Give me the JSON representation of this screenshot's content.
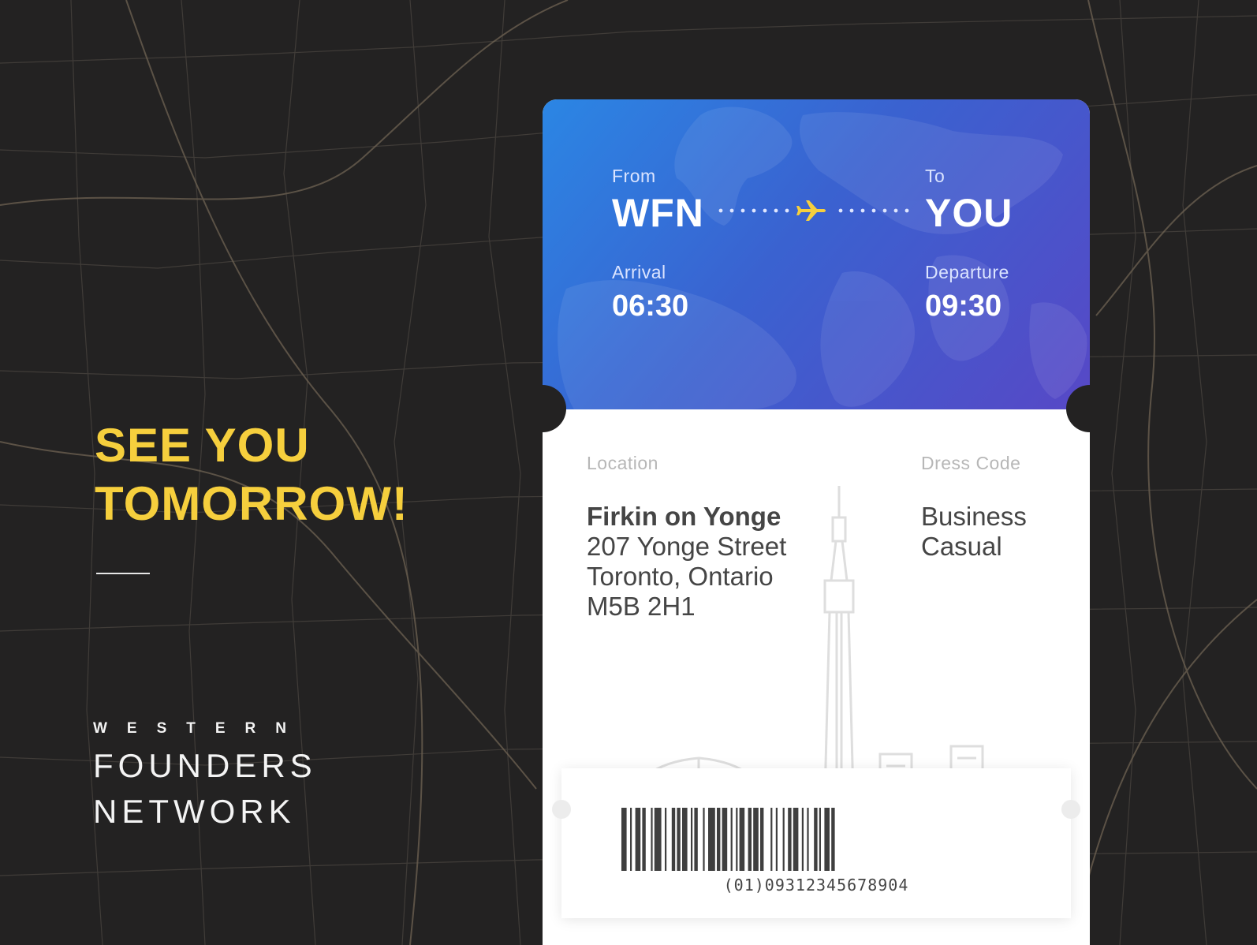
{
  "headline": {
    "line1": "SEE YOU",
    "line2": "TOMORROW!"
  },
  "brand": {
    "top": "WESTERN",
    "line1": "FOUNDERS",
    "line2": "NETWORK"
  },
  "ticket": {
    "from_label": "From",
    "from_code": "WFN",
    "to_label": "To",
    "to_code": "YOU",
    "arrival_label": "Arrival",
    "arrival_time": "06:30",
    "departure_label": "Departure",
    "departure_time": "09:30",
    "location_label": "Location",
    "venue": "Firkin on Yonge",
    "address_line1": "207 Yonge Street",
    "address_line2": "Toronto, Ontario",
    "postal_code": "M5B 2H1",
    "dress_label": "Dress Code",
    "dress_line1": "Business",
    "dress_line2": "Casual",
    "barcode_number": "(01)09312345678904"
  },
  "colors": {
    "accent_yellow": "#f6cf3d",
    "gradient_start": "#2b86e4",
    "gradient_end": "#5748c6",
    "background": "#232222"
  },
  "icons": {
    "plane": "airplane-icon",
    "skyline": "toronto-skyline-illustration"
  }
}
